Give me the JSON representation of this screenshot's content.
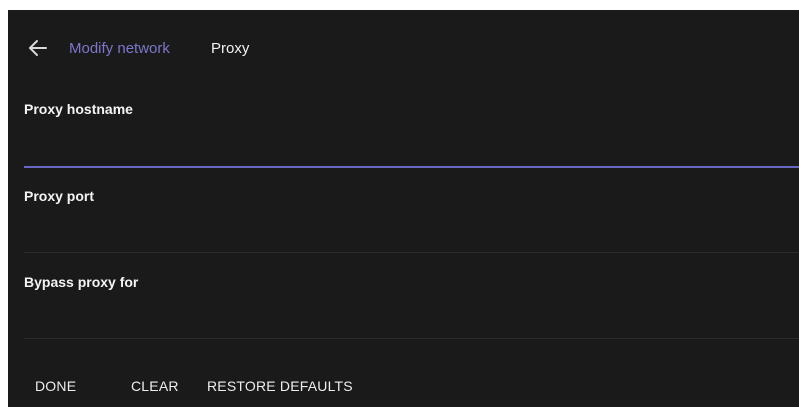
{
  "header": {
    "back_icon": "arrow-left-icon",
    "parent_label": "Modify network",
    "current_label": "Proxy",
    "accent_color": "#7b76c9"
  },
  "form": {
    "hostname": {
      "label": "Proxy hostname",
      "value": "",
      "focused": true
    },
    "port": {
      "label": "Proxy port",
      "value": ""
    },
    "bypass": {
      "label": "Bypass proxy for",
      "value": ""
    }
  },
  "actions": {
    "done_label": "DONE",
    "clear_label": "CLEAR",
    "restore_label": "RESTORE DEFAULTS"
  },
  "colors": {
    "background": "#1b1a1a",
    "focus_underline": "#6a66c4",
    "text": "#f4f4f4"
  }
}
